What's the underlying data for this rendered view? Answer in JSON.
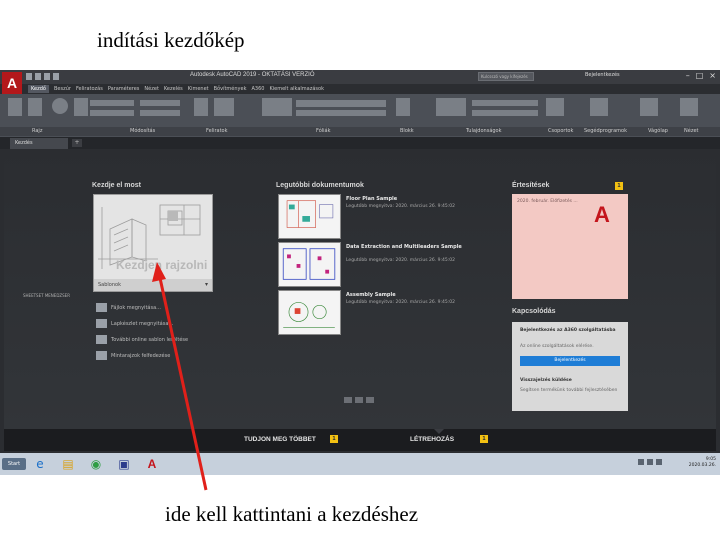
{
  "slide": {
    "title": "indítási kezdőkép",
    "caption": "ide kell kattintani a kezdéshez"
  },
  "titlebar": {
    "app_logo": "A",
    "window_title": "Autodesk AutoCAD 2019 - OKTATÁSI VERZIÓ",
    "search_placeholder": "Kulcsszó vagy kifejezés",
    "signin": "Bejelentkezés",
    "win_buttons": [
      "–",
      "□",
      "×"
    ]
  },
  "ribbon": {
    "tabs": [
      "Kezdő",
      "Beszúr",
      "Feliratozás",
      "Paraméteres",
      "Nézet",
      "Kezelés",
      "Kimenet",
      "Bővítmények",
      "A360",
      "Kiemelt alkalmazások"
    ],
    "active_tab": "Kezdő",
    "panels": [
      "Rajz",
      "Módosítás",
      "Feliratok",
      "Fóliák",
      "Blokk",
      "Tulajdonságok",
      "Csoportok",
      "Segédprogramok",
      "Vágólap",
      "Nézet"
    ]
  },
  "doc_tabs": {
    "active": "Kezdés",
    "add_symbol": "+"
  },
  "start_page": {
    "get_started": {
      "heading": "Kezdje el most",
      "card_label": "Kezdjen rajzolni",
      "template_label": "Sablonok",
      "side_link": "SHEETSET MENEDZSER",
      "actions": [
        "Fájlok megnyitása...",
        "Lapkészlet megnyitása...",
        "További online sablon letöltése",
        "Mintarajzok felfedezése"
      ]
    },
    "recent_docs": {
      "heading": "Legutóbbi dokumentumok",
      "items": [
        {
          "name": "Floor Plan Sample",
          "date": "Legutóbb megnyitva: 2020. március 26. 9:45:02"
        },
        {
          "name": "Data Extraction and Multileaders Sample",
          "date": "Legutóbb megnyitva: 2020. március 26. 9:45:02"
        },
        {
          "name": "Assembly Sample",
          "date": "Legutóbb megnyitva: 2020. március 26. 9:45:02"
        }
      ]
    },
    "notifications": {
      "heading": "Értesítések",
      "badge": "1",
      "text": "2020. február. Előfizetés ...",
      "logo_letter": "A"
    },
    "connect": {
      "heading": "Kapcsolódás",
      "signin_title": "Bejelentkezés az A360 szolgáltatásba",
      "signin_sub": "Az online szolgáltatások elérése.",
      "signin_button": "Bejelentkezés",
      "feedback_title": "Visszajelzés küldése",
      "feedback_sub": "Segítsen termékünk további fejlesztésében"
    }
  },
  "bottom_nav": {
    "learn": "TUDJON MEG TÖBBET",
    "create": "LÉTREHOZÁS",
    "learn_badge": "1",
    "create_badge": "1"
  },
  "taskbar": {
    "start_label": "Start",
    "time": "9:05",
    "date": "2020.03.26."
  },
  "colors": {
    "accent_red": "#c4151c",
    "arrow_red": "#e0201a",
    "link_blue": "#1e7dd6"
  }
}
